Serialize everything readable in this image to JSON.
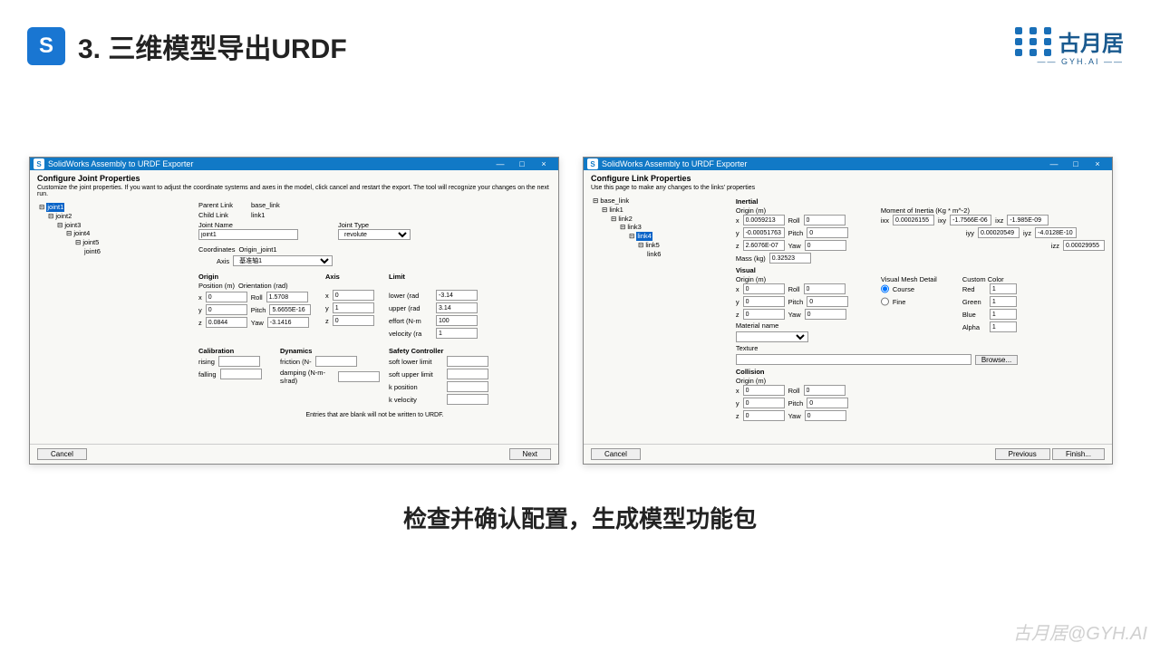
{
  "header": {
    "title": "3. 三维模型导出URDF",
    "brand": "古月居",
    "brand_sub": "—— GYH.AI ——"
  },
  "caption": "检查并确认配置，生成模型功能包",
  "watermark": "古月居@GYH.AI",
  "window_title": "SolidWorks Assembly to URDF Exporter",
  "left": {
    "heading": "Configure Joint Properties",
    "sub": "Customize the joint properties. If you want to adjust the coordinate systems and axes in the model, click cancel and restart the export. The tool will recognize your changes on the next run.",
    "tree": [
      "joint1",
      "joint2",
      "joint3",
      "joint4",
      "joint5",
      "joint6"
    ],
    "selected": "joint1",
    "parent_label": "Parent Link",
    "parent": "base_link",
    "child_label": "Child Link",
    "child": "link1",
    "jname_label": "Joint Name",
    "jname": "joint1",
    "jtype_label": "Joint Type",
    "jtype": "revolute",
    "coord_label": "Coordinates",
    "coord": "Origin_joint1",
    "axis_label": "Axis",
    "axis": "基准轴1",
    "origin_h": "Origin",
    "pos_h": "Position (m)",
    "ori_h": "Orientation (rad)",
    "x": "0",
    "y": "0",
    "z": "0.0844",
    "roll": "1.5708",
    "pitch": "5.6655E-16",
    "yaw": "-3.1416",
    "axis_h": "Axis",
    "ax": "0",
    "ay": "1",
    "az": "0",
    "limit_h": "Limit",
    "lower_l": "lower (rad",
    "lower": "-3.14",
    "upper_l": "upper (rad",
    "upper": "3.14",
    "effort_l": "effort (N-m",
    "effort": "100",
    "vel_l": "velocity (ra",
    "vel": "1",
    "cal_h": "Calibration",
    "rise_l": "rising",
    "fall_l": "falling",
    "dyn_h": "Dynamics",
    "fric_l": "friction (N-",
    "damp_l": "damping (N-m-s/rad)",
    "safe_h": "Safety Controller",
    "sll": "soft lower limit",
    "sul": "soft upper limit",
    "kp": "k position",
    "kv": "k velocity",
    "note": "Entries that are blank will not be written to URDF.",
    "cancel": "Cancel",
    "next": "Next"
  },
  "right": {
    "heading": "Configure Link Properties",
    "sub": "Use this page to make any changes to the links' properties",
    "tree": [
      "base_link",
      "link1",
      "link2",
      "link3",
      "link4",
      "link5",
      "link6"
    ],
    "selected": "link4",
    "inertial_h": "Inertial",
    "origin_h": "Origin (m)",
    "moi_h": "Moment of Inertia (Kg * m^-2)",
    "x": "0.0059213",
    "y": "-0.00051763",
    "z": "2.6076E-07",
    "roll": "0",
    "pitch": "0",
    "yaw": "0",
    "ixx": "0.00026155",
    "ixy": "-1.7566E-06",
    "ixz": "-1.985E-09",
    "iyy": "0.00020549",
    "iyz": "-4.0128E-10",
    "izz": "0.00029955",
    "mass_l": "Mass (kg)",
    "mass": "0.32523",
    "visual_h": "Visual",
    "vmd_h": "Visual Mesh Detail",
    "cc_h": "Custom Color",
    "course": "Course",
    "fine": "Fine",
    "red_l": "Red",
    "red": "1",
    "green_l": "Green",
    "green": "1",
    "blue_l": "Blue",
    "blue": "1",
    "alpha_l": "Alpha",
    "alpha": "1",
    "mat_l": "Material name",
    "tex_l": "Texture",
    "browse": "Browse...",
    "col_h": "Collision",
    "cancel": "Cancel",
    "prev": "Previous",
    "finish": "Finish..."
  }
}
